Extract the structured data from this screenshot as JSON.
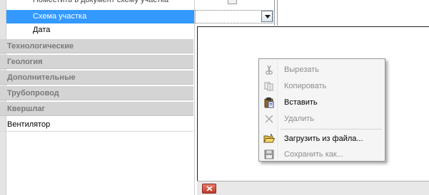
{
  "grid": {
    "top_row_label": "Поместить в документ схему участка",
    "selected_row_label": "Схема участка",
    "date_row_label": "Дата",
    "categories": [
      "Технологические",
      "Геология",
      "Дополнительные",
      "Трубопровод",
      "Квершлаг"
    ],
    "fan_label": "Вентилятор"
  },
  "context_menu": {
    "items": [
      {
        "label": "Вырезать",
        "icon": "scissors-icon",
        "enabled": false
      },
      {
        "label": "Копировать",
        "icon": "copy-icon",
        "enabled": false
      },
      {
        "label": "Вставить",
        "icon": "paste-icon",
        "enabled": true
      },
      {
        "label": "Удалить",
        "icon": "delete-x-icon",
        "enabled": false
      },
      {
        "label": "Загрузить из файла...",
        "icon": "open-folder-icon",
        "enabled": true
      },
      {
        "label": "Сохранить как...",
        "icon": "floppy-save-icon",
        "enabled": false
      }
    ]
  },
  "colors": {
    "selection": "#3399ff",
    "category_bg": "#d4d4d4",
    "category_text": "#7a7a7a",
    "close_button": "#c0392b"
  }
}
